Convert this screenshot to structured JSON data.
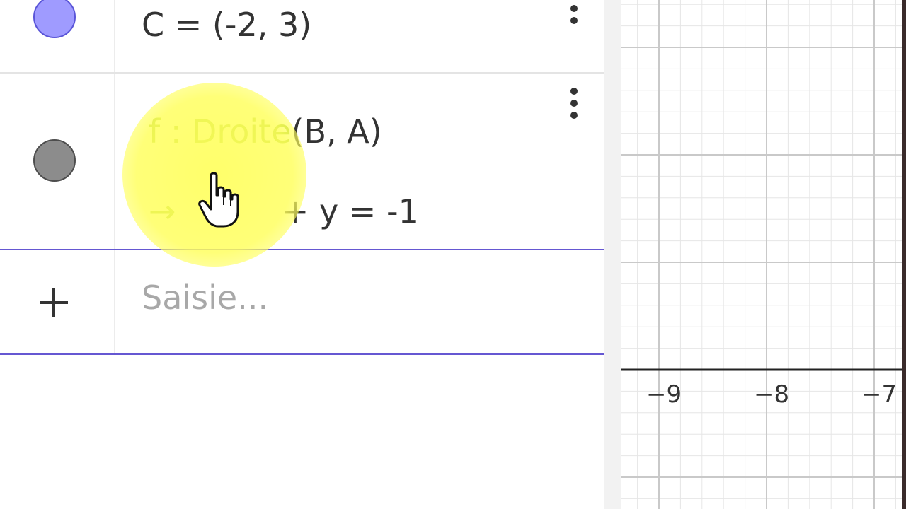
{
  "algebra": {
    "items": [
      {
        "name": "C",
        "expression": "C = (-2, 3)",
        "color": "#9f9bff"
      },
      {
        "name": "f",
        "label_prefix": "f : Droite",
        "label_args": "(B, A)",
        "output_hidden": "→",
        "output_visible": "+ y = -1",
        "color": "#8c8c8c",
        "label_color": "#9bc438"
      }
    ],
    "input": {
      "placeholder": "Saisie..."
    },
    "accent_color": "#6557d2"
  },
  "graphics": {
    "x_ticks": [
      "−9",
      "−8",
      "−7"
    ]
  }
}
